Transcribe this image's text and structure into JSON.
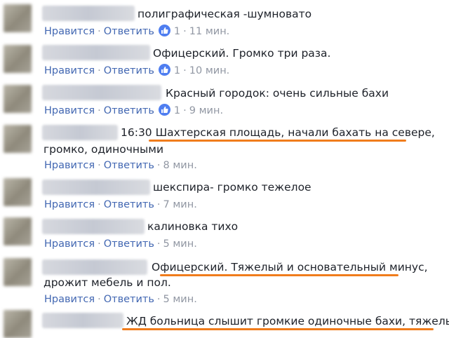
{
  "actions": {
    "like": "Нравится",
    "reply": "Ответить",
    "sep": "·"
  },
  "comments": [
    {
      "text": "полиграфическая -шумновато",
      "likes": "1",
      "time": "11 мин."
    },
    {
      "text": "Офицерский. Громко три раза.",
      "likes": "1",
      "time": "10 мин."
    },
    {
      "text": "Красный городок: очень сильные бахи",
      "likes": "1",
      "time": "9 мин."
    },
    {
      "text": "16:30 Шахтерская площадь, начали бахать на севере,",
      "text2": "громко, одиночными",
      "time": "8 мин."
    },
    {
      "text": "шекспира- громко тежелое",
      "time": "7 мин."
    },
    {
      "text": "калиновка тихо",
      "time": "5 мин."
    },
    {
      "text": "Офицерский. Тяжелый и основательный минус,",
      "text2": "дрожит мебель и пол.",
      "time": "5 мин."
    },
    {
      "text": "ЖД больница слышит громкие одиночные бахи, тяжелые."
    }
  ],
  "colors": {
    "link": "#4267b2",
    "meta": "#9197a3",
    "highlight": "#f07c1c",
    "like_badge": "#4f7ef0"
  }
}
